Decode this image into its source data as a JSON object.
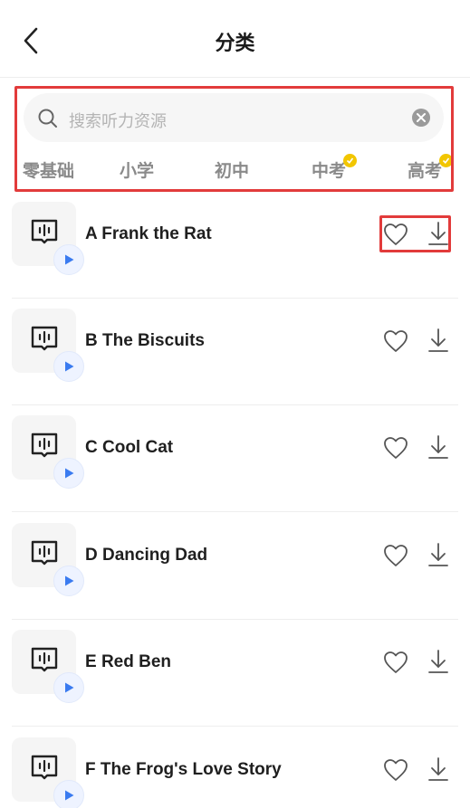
{
  "header": {
    "title": "分类"
  },
  "search": {
    "placeholder": "搜索听力资源"
  },
  "tabs": [
    {
      "label": "零基础",
      "badge": false
    },
    {
      "label": "小学",
      "badge": false
    },
    {
      "label": "初中",
      "badge": false
    },
    {
      "label": "中考",
      "badge": true
    },
    {
      "label": "高考",
      "badge": true
    }
  ],
  "items": [
    {
      "title": "A Frank the Rat"
    },
    {
      "title": "B The Biscuits"
    },
    {
      "title": "C Cool Cat"
    },
    {
      "title": "D Dancing Dad"
    },
    {
      "title": "E Red Ben"
    },
    {
      "title": "F The Frog's Love Story"
    }
  ],
  "colors": {
    "highlight": "#e23b3b",
    "play": "#3a7bf0",
    "badge": "#f2c600"
  }
}
